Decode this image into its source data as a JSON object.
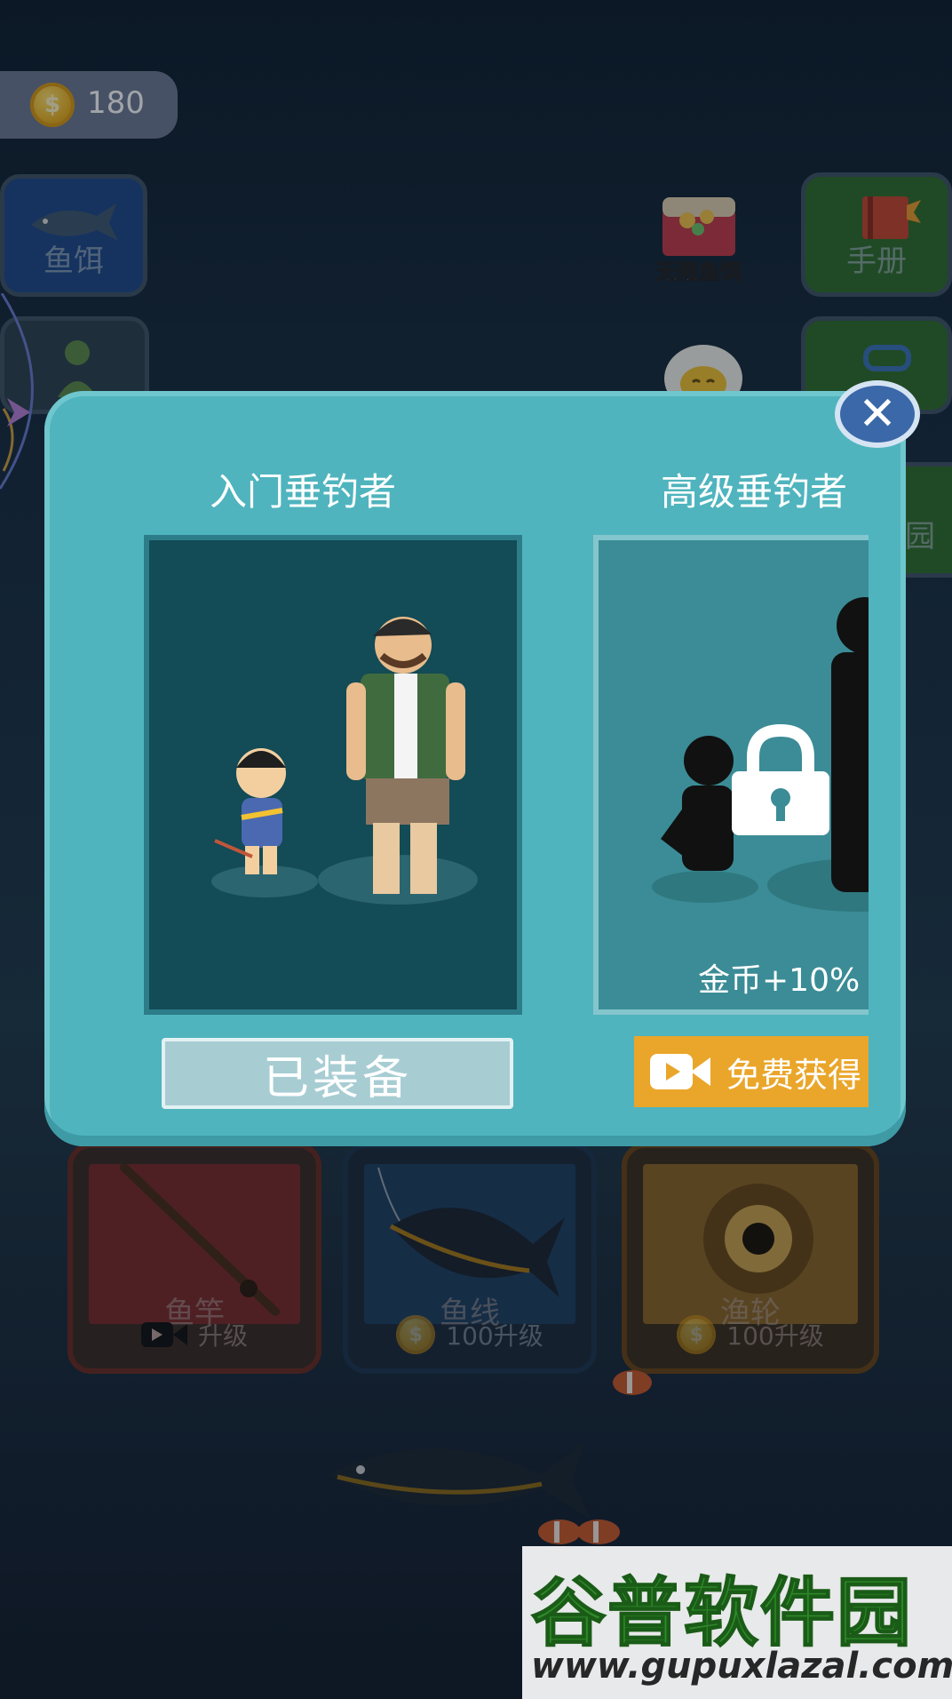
{
  "hud": {
    "coins": "180",
    "coin_symbol": "$"
  },
  "side_menu": {
    "bait_label": "鱼饵",
    "handbook_label": "手册",
    "unlimited_bait_label": "无限鱼饵",
    "right_partial_label": "园"
  },
  "upgrades": [
    {
      "name": "鱼竿",
      "action_label": "升级",
      "cost_type": "video"
    },
    {
      "name": "鱼线",
      "cost_label": "100升级",
      "cost_type": "coin"
    },
    {
      "name": "渔轮",
      "cost_label": "100升级",
      "cost_type": "coin"
    }
  ],
  "modal": {
    "close_symbol": "✕",
    "tiers": [
      {
        "title": "入门垂钓者",
        "button": "已装备",
        "locked": false
      },
      {
        "title": "高级垂钓者",
        "bonus": "金币+10%",
        "button": "免费获得",
        "locked": true
      }
    ]
  },
  "watermark": {
    "title": "谷普软件园",
    "url": "www.gupuxlazal.com"
  },
  "colors": {
    "modal": "#4fb4be",
    "card_bg": "#134b56",
    "free_button": "#eaa62a",
    "close_button": "#3b68a8"
  }
}
